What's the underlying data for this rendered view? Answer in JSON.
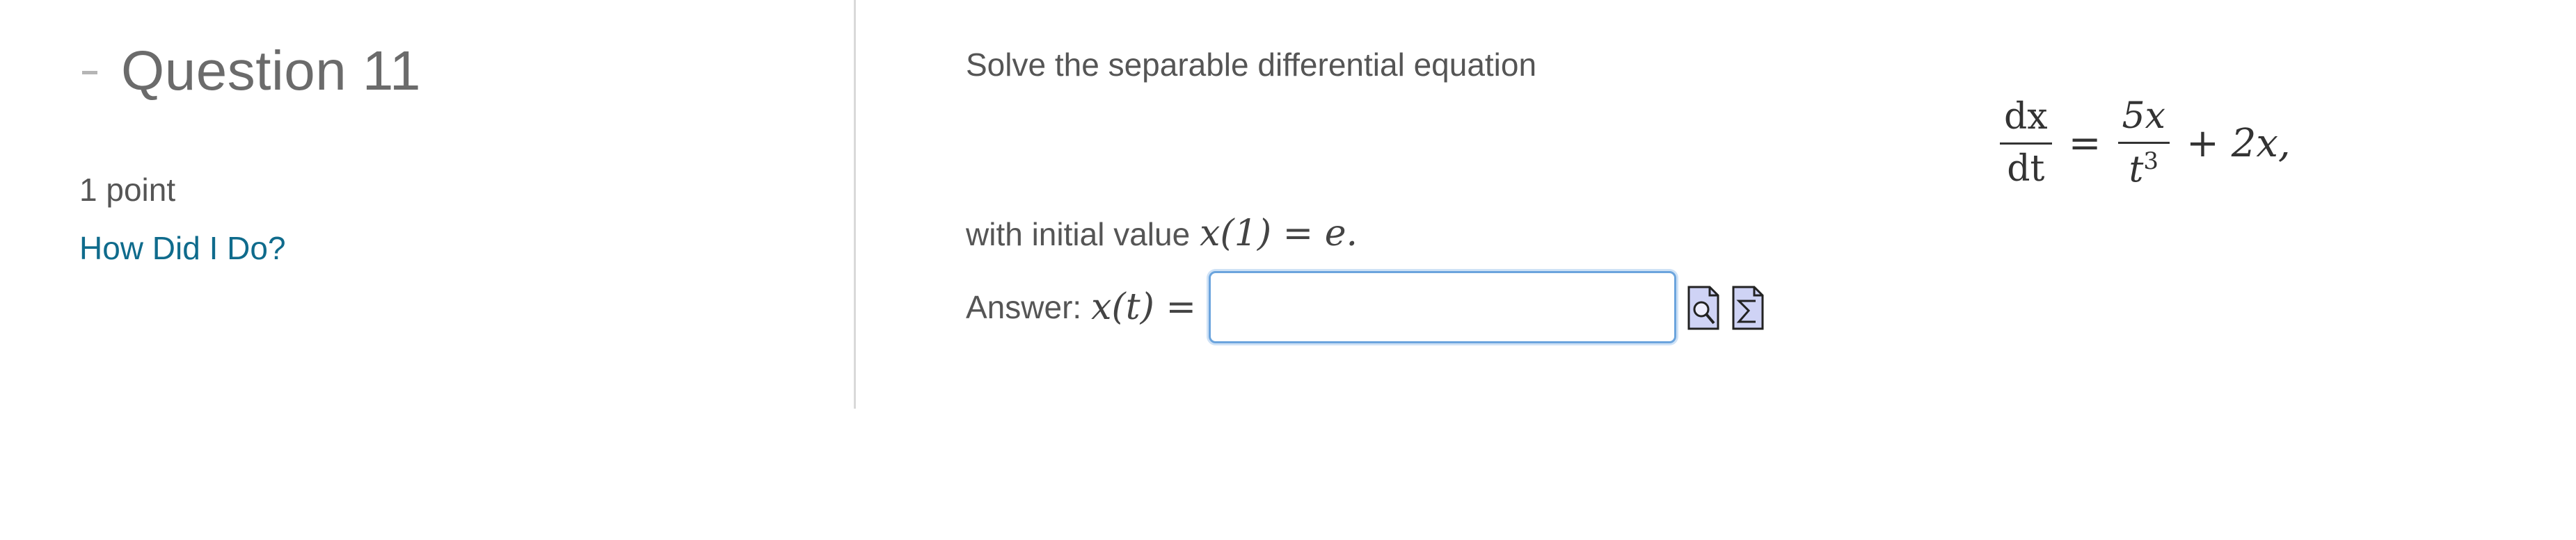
{
  "question": {
    "title": "Question 11",
    "points": "1 point",
    "help_link": "How Did I Do?"
  },
  "problem": {
    "prompt": "Solve the separable differential equation",
    "equation": {
      "lhs_num": "dx",
      "lhs_den": "dt",
      "equals": "=",
      "rhs_num": "5x",
      "rhs_den_base": "t",
      "rhs_den_exp": "3",
      "rhs_tail": "+ 2x,"
    },
    "initial_label": "with initial value",
    "initial_math": "x(1) = e."
  },
  "answer": {
    "label": "Answer:",
    "math": "x(t) =",
    "value": "",
    "placeholder": ""
  },
  "icons": {
    "preview": "preview-icon",
    "equation_editor": "equation-editor-icon",
    "accent_color": "#6ba4dd",
    "link_color": "#0f6b8c"
  }
}
